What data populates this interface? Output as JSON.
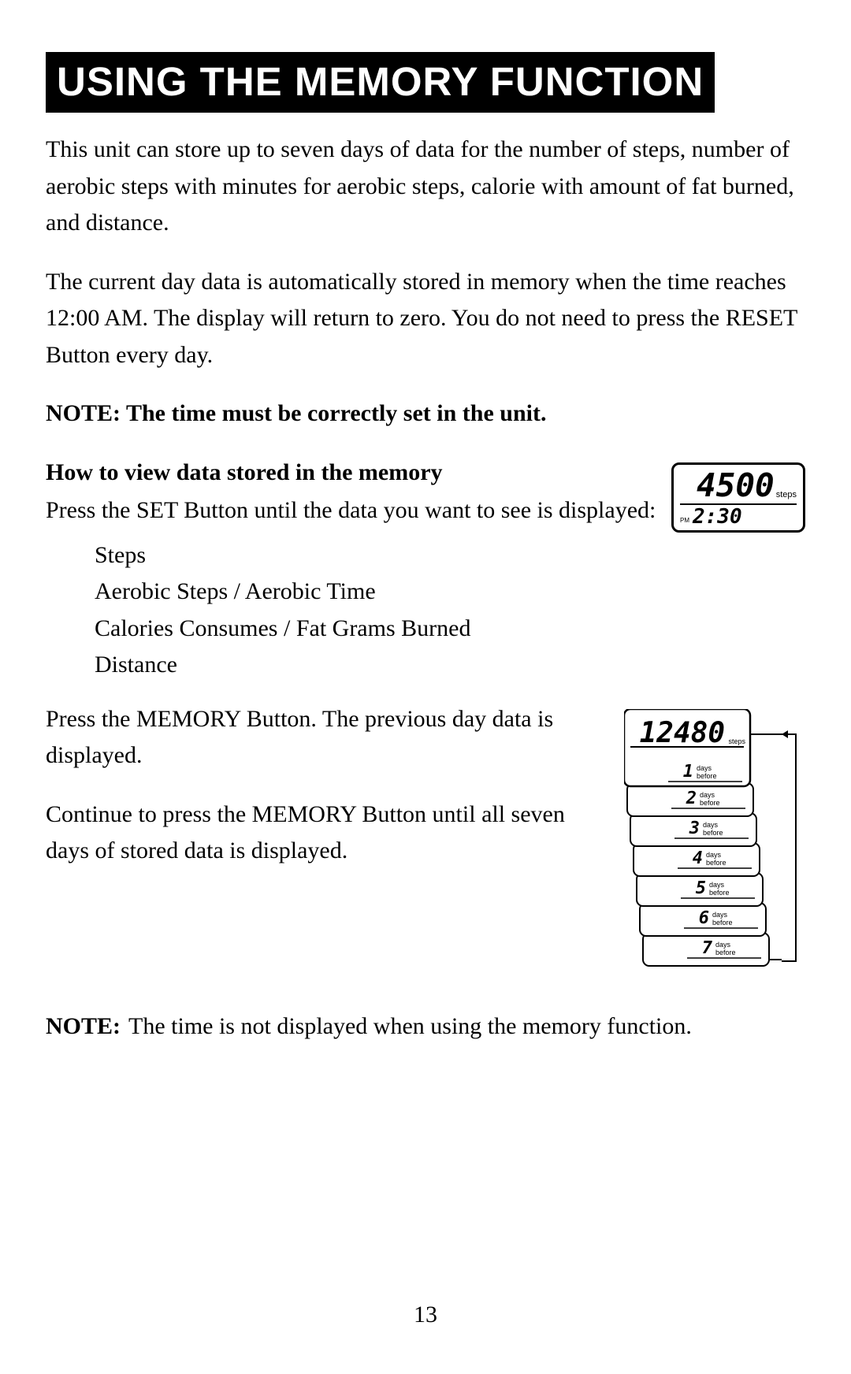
{
  "title": "USING THE MEMORY FUNCTION",
  "para1": "This unit can store up to seven days of data for the number of steps, number of aerobic steps with minutes for aerobic steps, calorie with amount of fat burned, and distance.",
  "para2": "The current day data is automatically stored in memory when the time reaches 12:00 AM. The display will return to zero. You do not need to press the RESET Button every day.",
  "note1": "NOTE: The time must be correctly set in the unit.",
  "subhead": "How to view data stored in the memory",
  "howto_intro": "Press the SET Button until the data you want to see is displayed:",
  "list": {
    "item1": "Steps",
    "item2": "Aerobic Steps / Aerobic Time",
    "item3": "Calories Consumes / Fat Grams Burned",
    "item4": "Distance"
  },
  "memory1": "Press the MEMORY Button. The previous day data is displayed.",
  "memory2": "Continue to press the MEMORY Button until all seven days of stored data is displayed.",
  "note2_label": "NOTE:",
  "note2_text": "The time is not displayed when using the memory function.",
  "page_number": "13",
  "lcd1": {
    "value": "4500",
    "unit": "steps",
    "pm": "PM",
    "time": "2:30"
  },
  "lcd_stack": {
    "top_value": "12480",
    "top_unit": "steps",
    "days_label_line1": "days",
    "days_label_line2": "before",
    "days": [
      "1",
      "2",
      "3",
      "4",
      "5",
      "6",
      "7"
    ]
  }
}
